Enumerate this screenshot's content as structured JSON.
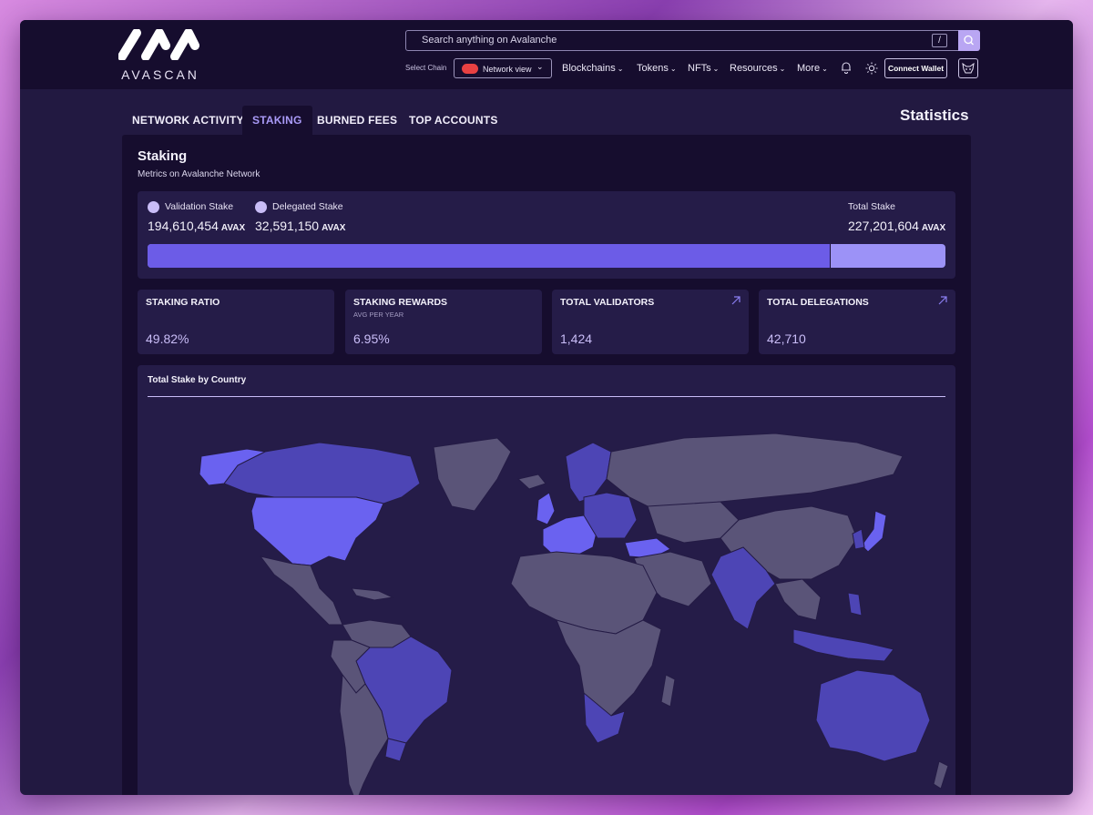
{
  "header": {
    "logo_text": "AVASCAN",
    "search_placeholder": "Search anything on Avalanche",
    "search_shortcut": "/",
    "select_chain_label": "Select Chain",
    "chain_value": "Network view",
    "nav": [
      "Blockchains",
      "Tokens",
      "NFTs",
      "Resources",
      "More"
    ],
    "connect_wallet": "Connect Wallet"
  },
  "tabs": [
    {
      "label": "NETWORK ACTIVITY",
      "active": false
    },
    {
      "label": "STAKING",
      "active": true
    },
    {
      "label": "BURNED FEES",
      "active": false
    },
    {
      "label": "TOP ACCOUNTS",
      "active": false
    }
  ],
  "page_title": "Statistics",
  "panel": {
    "title": "Staking",
    "subtitle": "Metrics on Avalanche Network",
    "validation_label": "Validation Stake",
    "validation_value": "194,610,454",
    "delegated_label": "Delegated Stake",
    "delegated_value": "32,591,150",
    "total_label": "Total Stake",
    "total_value": "227,201,604",
    "unit": "AVAX",
    "validation_fraction": 0.8566
  },
  "metrics": [
    {
      "label": "STAKING RATIO",
      "sub": "",
      "value": "49.82%",
      "link": false
    },
    {
      "label": "STAKING REWARDS",
      "sub": "AVG PER YEAR",
      "value": "6.95%",
      "link": false
    },
    {
      "label": "TOTAL VALIDATORS",
      "sub": "",
      "value": "1,424",
      "link": true
    },
    {
      "label": "TOTAL DELEGATIONS",
      "sub": "",
      "value": "42,710",
      "link": true
    }
  ],
  "map": {
    "title": "Total Stake by Country"
  },
  "colors": {
    "accent": "#a99af7",
    "bar_validation": "#6c5ce7",
    "bar_delegated": "#9c92f7",
    "map_land": "#5a5478",
    "map_highlight": "#4d45b5",
    "map_top": "#6a62f0"
  }
}
